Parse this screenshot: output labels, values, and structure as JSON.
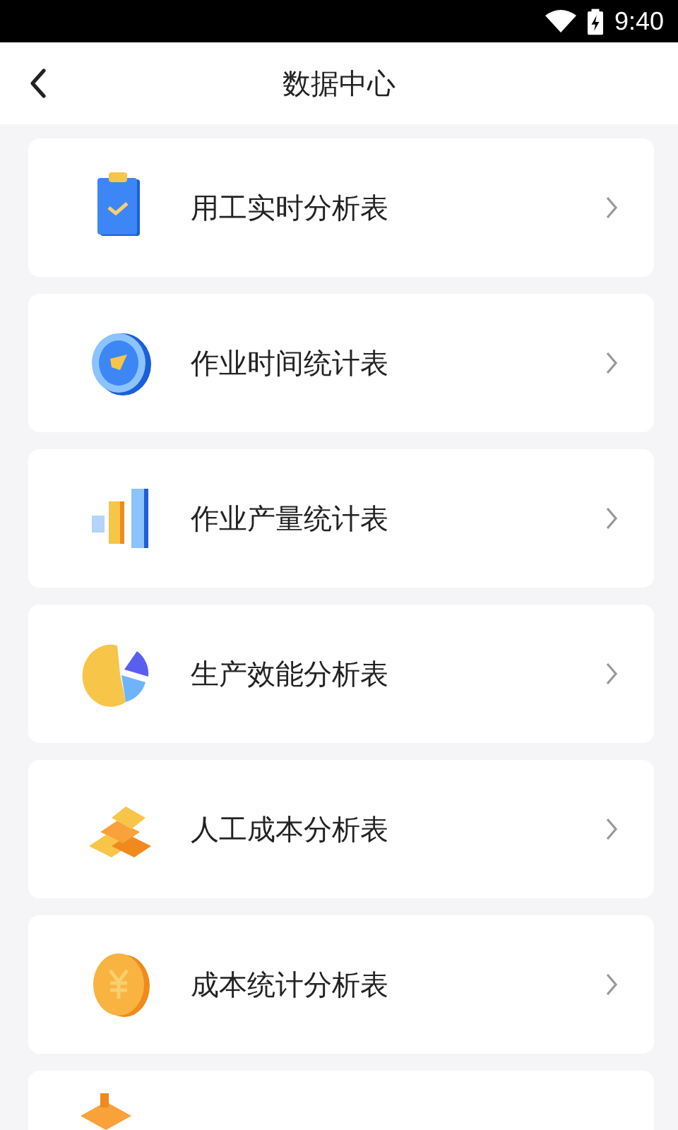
{
  "status_bar": {
    "time": "9:40"
  },
  "header": {
    "title": "数据中心"
  },
  "items": [
    {
      "kind": "row",
      "label": "用工实时分析表"
    },
    {
      "kind": "row",
      "label": "作业时间统计表"
    },
    {
      "kind": "row",
      "label": "作业产量统计表"
    },
    {
      "kind": "row",
      "label": "生产效能分析表"
    },
    {
      "kind": "row",
      "label": "人工成本分析表"
    },
    {
      "kind": "row",
      "label": "成本统计分析表"
    },
    {
      "kind": "partial"
    }
  ]
}
